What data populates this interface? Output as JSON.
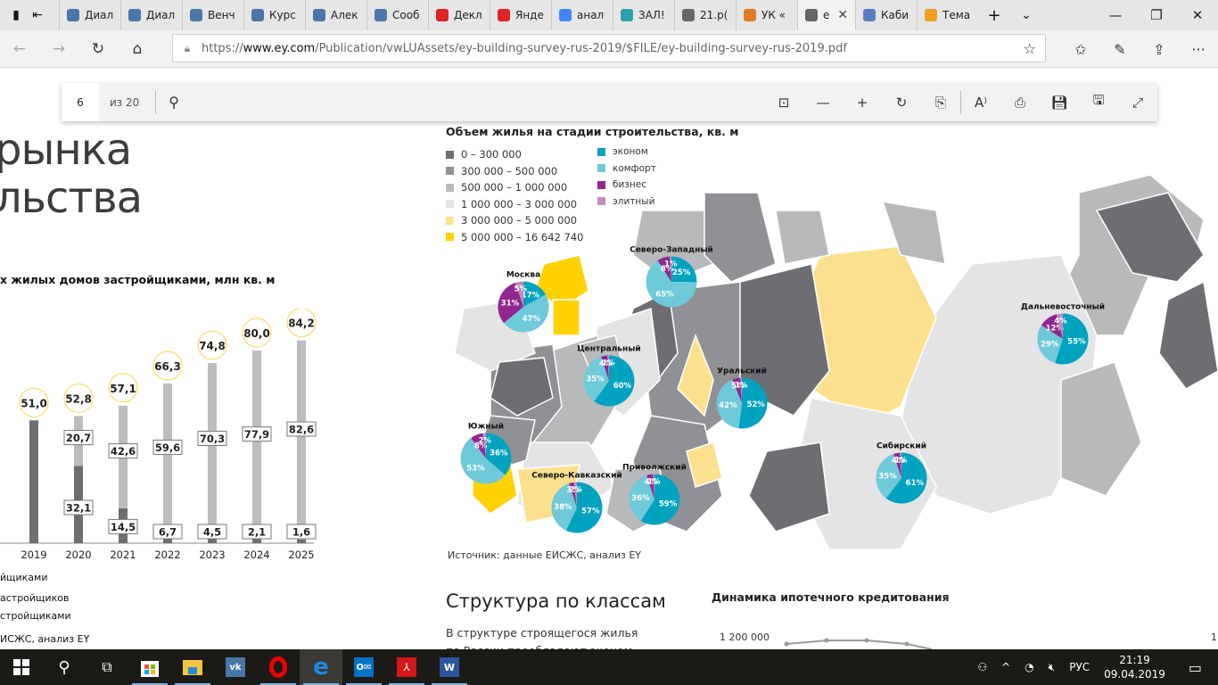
{
  "browser": {
    "tabs": [
      {
        "label": "Диал",
        "icon": "chat-icon",
        "color": "#4a76a8"
      },
      {
        "label": "Диал",
        "icon": "vk-icon",
        "color": "#4a76a8"
      },
      {
        "label": "Венч",
        "icon": "vk-icon",
        "color": "#4a76a8"
      },
      {
        "label": "Курс",
        "icon": "vk-icon",
        "color": "#4a76a8"
      },
      {
        "label": "Алек",
        "icon": "vk-icon",
        "color": "#4a76a8"
      },
      {
        "label": "Сооб",
        "icon": "vk-icon",
        "color": "#4a76a8"
      },
      {
        "label": "Декл",
        "icon": "24-icon",
        "color": "#e02424"
      },
      {
        "label": "Янде",
        "icon": "yandex-icon",
        "color": "#e02424"
      },
      {
        "label": "анал",
        "icon": "google-icon",
        "color": "#4285f4"
      },
      {
        "label": "ЗАЛ!",
        "icon": "zal-icon",
        "color": "#2aa0b0"
      },
      {
        "label": "21.р(",
        "icon": "page-icon",
        "color": "#666666"
      },
      {
        "label": "УК «",
        "icon": "uk-icon",
        "color": "#e07a20"
      },
      {
        "label": "е",
        "icon": "page-icon",
        "color": "#666666",
        "active": true
      },
      {
        "label": "Каби",
        "icon": "shield-icon",
        "color": "#5a7fc0"
      },
      {
        "label": "Тема",
        "icon": "24-icon",
        "color": "#f0a020"
      }
    ],
    "url_prefix": "https://",
    "url_host": "www.ey.com",
    "url_path": "/Publication/vwLUAssets/ey-building-survey-rus-2019/$FILE/ey-building-survey-rus-2019.pdf"
  },
  "pdf_toolbar": {
    "page": "6",
    "total": "из 20"
  },
  "left_page": {
    "title_line1": "рынка",
    "title_line2": "льства",
    "chart_title": "х жилых домов застройщиками, млн кв. м",
    "legend": [
      "йщиками",
      "астройщиков",
      "стройщиками"
    ],
    "source": "ИСЖС, анализ EY"
  },
  "chart_data": [
    {
      "type": "bar",
      "title": "… жилых домов застройщиками, млн кв. м",
      "categories": [
        "*",
        "2019",
        "2020",
        "2021",
        "2022",
        "2023",
        "2024",
        "2025"
      ],
      "totals": [
        null,
        51.0,
        52.8,
        57.1,
        66.3,
        74.8,
        80.0,
        84.2
      ],
      "total_labels": [
        "",
        "51,0",
        "52,8",
        "57,1",
        "66,3",
        "74,8",
        "80,0",
        "84,2"
      ],
      "series": [
        {
          "name": "dark",
          "values": [
            null,
            51.0,
            32.1,
            14.5,
            6.7,
            4.5,
            2.1,
            1.6
          ],
          "labels": [
            "",
            "",
            "32,1",
            "14,5",
            "6,7",
            "4,5",
            "2,1",
            "1,6"
          ],
          "color": "#6d6e71"
        },
        {
          "name": "light",
          "values": [
            null,
            0,
            20.7,
            42.6,
            59.6,
            70.3,
            77.9,
            82.6
          ],
          "labels": [
            "",
            "",
            "20,7",
            "42,6",
            "59,6",
            "70,3",
            "77,9",
            "82,6"
          ],
          "color": "#bcbdc0"
        }
      ],
      "ylim": [
        0,
        90
      ]
    },
    {
      "type": "pie",
      "title": "Объем жилья на стадии строительства, кв. м",
      "legend_volume": [
        {
          "label": "0 – 300 000",
          "color": "#6d6e71"
        },
        {
          "label": "300 000 – 500 000",
          "color": "#909194"
        },
        {
          "label": "500 000 – 1 000 000",
          "color": "#b8b9bb"
        },
        {
          "label": "1 000 000 – 3 000 000",
          "color": "#e4e4e5"
        },
        {
          "label": "3 000 000 – 5 000 000",
          "color": "#fde08e"
        },
        {
          "label": "5 000 000 – 16 642 740",
          "color": "#ffd200"
        }
      ],
      "legend_class": [
        {
          "label": "эконом",
          "color": "#00a3bf"
        },
        {
          "label": "комфорт",
          "color": "#6ec9d9"
        },
        {
          "label": "бизнес",
          "color": "#91278f"
        },
        {
          "label": "элитный",
          "color": "#c08bbf"
        }
      ],
      "regions": [
        {
          "name": "Москва",
          "slices": {
            "эконом": 17,
            "комфорт": 47,
            "бизнес": 31,
            "элитный": 5
          }
        },
        {
          "name": "Северо-Западный",
          "slices": {
            "эконом": 25,
            "комфорт": 65,
            "бизнес": 8,
            "элитный": 1
          }
        },
        {
          "name": "Центральный",
          "slices": {
            "эконом": 60,
            "комфорт": 35,
            "бизнес": 4,
            "элитный": 1
          }
        },
        {
          "name": "Уральский",
          "slices": {
            "эконом": 52,
            "комфорт": 42,
            "бизнес": 5,
            "элитный": 1
          }
        },
        {
          "name": "Дальневосточный",
          "slices": {
            "эконом": 55,
            "комфорт": 29,
            "бизнес": 12,
            "элитный": 4
          }
        },
        {
          "name": "Южный",
          "slices": {
            "эконом": 36,
            "комфорт": 53,
            "бизнес": 8,
            "элитный": 2
          }
        },
        {
          "name": "Северо-Кавказский",
          "slices": {
            "эконом": 57,
            "комфорт": 38,
            "бизнес": 3,
            "элитный": 2
          }
        },
        {
          "name": "Приволжский",
          "slices": {
            "эконом": 59,
            "комфорт": 36,
            "бизнес": 4,
            "элитный": 1
          }
        },
        {
          "name": "Сибирский",
          "slices": {
            "эконом": 61,
            "комфорт": 35,
            "бизнес": 4,
            "элитный": 1
          }
        }
      ]
    }
  ],
  "right_page": {
    "source": "Источник: данные ЕИСЖС, анализ EY",
    "section_title": "Структура по классам",
    "paragraph_line1": "В структуре строящегося жилья",
    "paragraph_line2": "по России преобладают эконом",
    "mortgage_title": "Динамика ипотечного кредитования",
    "mortgage_y_label": "1 200 000",
    "mortgage_y_label_right": "1"
  },
  "taskbar": {
    "lang": "РУС",
    "time": "21:19",
    "date": "09.04.2019"
  }
}
